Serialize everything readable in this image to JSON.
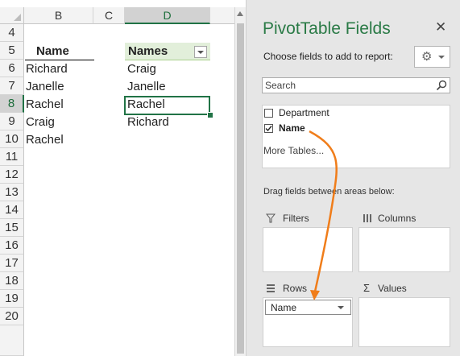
{
  "sheet": {
    "columns": [
      "B",
      "C",
      "D"
    ],
    "selected_column": "D",
    "rows": [
      "4",
      "5",
      "6",
      "7",
      "8",
      "9",
      "10",
      "11",
      "12",
      "13",
      "14",
      "15",
      "16",
      "17",
      "18",
      "19",
      "20"
    ],
    "selected_row": "8",
    "colB": [
      "Name",
      "Richard",
      "Janelle",
      "Rachel",
      "Craig",
      "Rachel"
    ],
    "colD": [
      "Names",
      "Craig",
      "Janelle",
      "Rachel",
      "Richard"
    ],
    "active_cell_value": "Rachel"
  },
  "pane": {
    "title": "PivotTable Fields",
    "close_icon": "close-icon",
    "choose_label": "Choose fields to add to report:",
    "search_placeholder": "Search",
    "fields": [
      {
        "label": "Department",
        "checked": false
      },
      {
        "label": "Name",
        "checked": true
      }
    ],
    "more_tables": "More Tables...",
    "drag_message": "Drag fields between areas below:",
    "areas": {
      "filters": "Filters",
      "columns": "Columns",
      "rows": "Rows",
      "values": "Values"
    },
    "rows_chip": "Name",
    "accent_color": "#217346",
    "arrow_color": "#f07d1a"
  }
}
